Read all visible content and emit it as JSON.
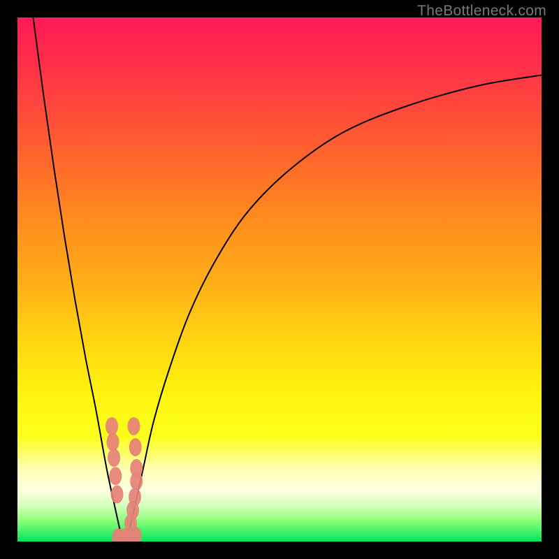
{
  "watermark": {
    "text": "TheBottleneck.com"
  },
  "chart_data": {
    "type": "line",
    "title": "",
    "xlabel": "",
    "ylabel": "",
    "xlim": [
      0,
      100
    ],
    "ylim": [
      0,
      100
    ],
    "grid": false,
    "legend": false,
    "series": [
      {
        "name": "left-branch",
        "x": [
          3,
          5,
          7,
          9,
          11,
          13,
          15,
          17,
          18.5,
          19.5,
          20,
          20.5
        ],
        "y": [
          100,
          85,
          71,
          58,
          46,
          35,
          25,
          14,
          7,
          2.5,
          0.8,
          0
        ]
      },
      {
        "name": "right-branch",
        "x": [
          20.5,
          21,
          22,
          24,
          26,
          29,
          33,
          38,
          44,
          52,
          62,
          74,
          88,
          100
        ],
        "y": [
          0,
          1,
          5,
          14,
          23,
          33,
          44,
          54,
          63,
          71,
          78,
          83,
          87,
          89
        ]
      }
    ],
    "markers": {
      "name": "cluster-points",
      "color": "#e58179",
      "points": [
        {
          "x": 18.0,
          "y": 22
        },
        {
          "x": 18.2,
          "y": 19
        },
        {
          "x": 18.4,
          "y": 16
        },
        {
          "x": 18.7,
          "y": 12.5
        },
        {
          "x": 19.0,
          "y": 9
        },
        {
          "x": 22.2,
          "y": 22
        },
        {
          "x": 22.5,
          "y": 18
        },
        {
          "x": 22.7,
          "y": 14
        },
        {
          "x": 22.7,
          "y": 11.5
        },
        {
          "x": 22.4,
          "y": 8.5
        },
        {
          "x": 22.0,
          "y": 6
        },
        {
          "x": 21.6,
          "y": 3.5
        },
        {
          "x": 19.2,
          "y": 0.8
        },
        {
          "x": 20.4,
          "y": 0.8
        },
        {
          "x": 21.5,
          "y": 0.9
        },
        {
          "x": 22.5,
          "y": 1.1
        }
      ]
    },
    "background_gradient": {
      "top": "#ff1a56",
      "bottom": "#00e65a"
    }
  }
}
